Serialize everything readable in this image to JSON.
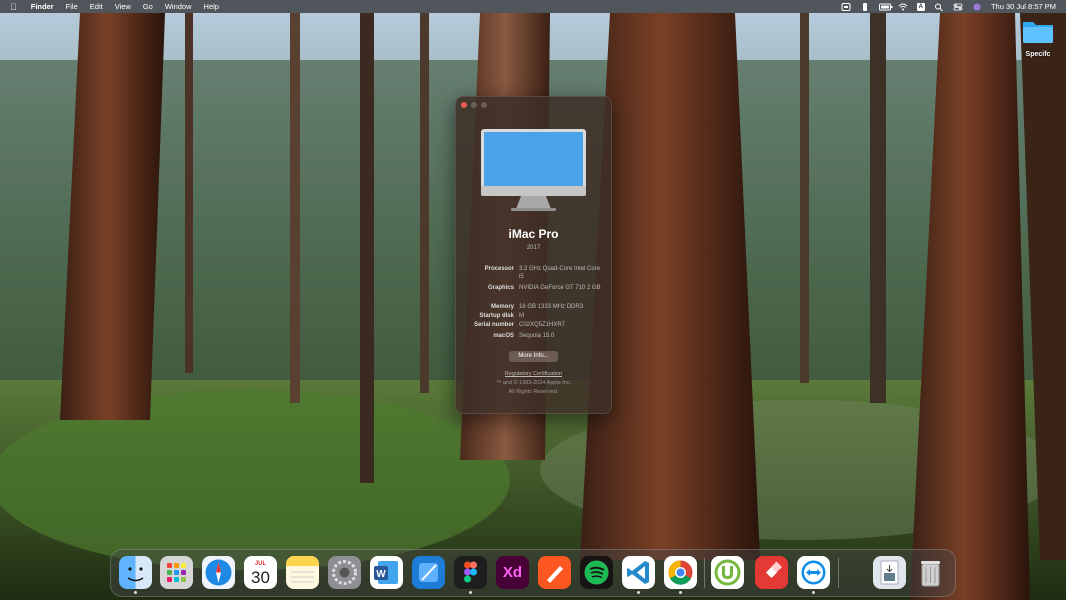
{
  "menubar": {
    "app_name": "Finder",
    "menus": [
      "File",
      "Edit",
      "View",
      "Go",
      "Window",
      "Help"
    ],
    "input_source": "A",
    "clock": "Thu 30 Jul  8:57 PM"
  },
  "desktop": {
    "folder_label": "Specifc"
  },
  "about": {
    "model": "iMac Pro",
    "year": "2017",
    "specs": [
      {
        "key": "Processor",
        "value": "3.2 GHz Quad-Core Intel Core i5"
      },
      {
        "key": "Graphics",
        "value": "NVIDIA GeForce GT 710 2 GB"
      },
      {
        "key": "Memory",
        "value": "16 GB 1333 MHz DDR3"
      },
      {
        "key": "Startup disk",
        "value": "M"
      },
      {
        "key": "Serial number",
        "value": "C02XQ5Z1HXR7"
      },
      {
        "key": "macOS",
        "value": "Sequoia 15.0"
      }
    ],
    "more_info_label": "More Info...",
    "regulatory_label": "Regulatory Certification",
    "copyright_line1": "™ and © 1983-2024 Apple Inc.",
    "copyright_line2": "All Rights Reserved."
  },
  "dock": {
    "calendar_month": "JUL",
    "calendar_day": "30",
    "apps": [
      {
        "name": "Finder",
        "icon": "finder-icon",
        "color": "#2f8cf3"
      },
      {
        "name": "Launchpad",
        "icon": "launchpad-icon",
        "color": "#dedede"
      },
      {
        "name": "Safari",
        "icon": "safari-icon",
        "color": "#1e88e5"
      },
      {
        "name": "Calendar",
        "icon": "calendar-icon",
        "color": "#ffffff"
      },
      {
        "name": "Notes",
        "icon": "notes-icon",
        "color": "#ffd54f"
      },
      {
        "name": "System Settings",
        "icon": "gear-icon",
        "color": "#8e8e93"
      },
      {
        "name": "Word",
        "icon": "word-icon",
        "color": "#2b579a"
      },
      {
        "name": "Xcode",
        "icon": "xcode-icon",
        "color": "#1c7cd6"
      },
      {
        "name": "Figma",
        "icon": "figma-icon",
        "color": "#1e1e1e"
      },
      {
        "name": "Adobe XD",
        "icon": "xd-icon",
        "color": "#470137"
      },
      {
        "name": "Sketch",
        "icon": "sketch-icon",
        "color": "#ff5722"
      },
      {
        "name": "Spotify",
        "icon": "spotify-icon",
        "color": "#191414"
      },
      {
        "name": "VS Code",
        "icon": "vscode-icon",
        "color": "#ffffff"
      },
      {
        "name": "Chrome",
        "icon": "chrome-icon",
        "color": "#ffffff"
      },
      {
        "name": "uTorrent",
        "icon": "utorrent-icon",
        "color": "#ffffff"
      },
      {
        "name": "AnyDesk",
        "icon": "anydesk-icon",
        "color": "#e53935"
      },
      {
        "name": "TeamViewer",
        "icon": "teamviewer-icon",
        "color": "#ffffff"
      },
      {
        "name": "Downloads",
        "icon": "downloads-stack-icon",
        "color": "#dfe6ee"
      },
      {
        "name": "Trash",
        "icon": "trash-icon",
        "color": "#c9c9c9"
      }
    ],
    "xd_label": "Xd"
  }
}
